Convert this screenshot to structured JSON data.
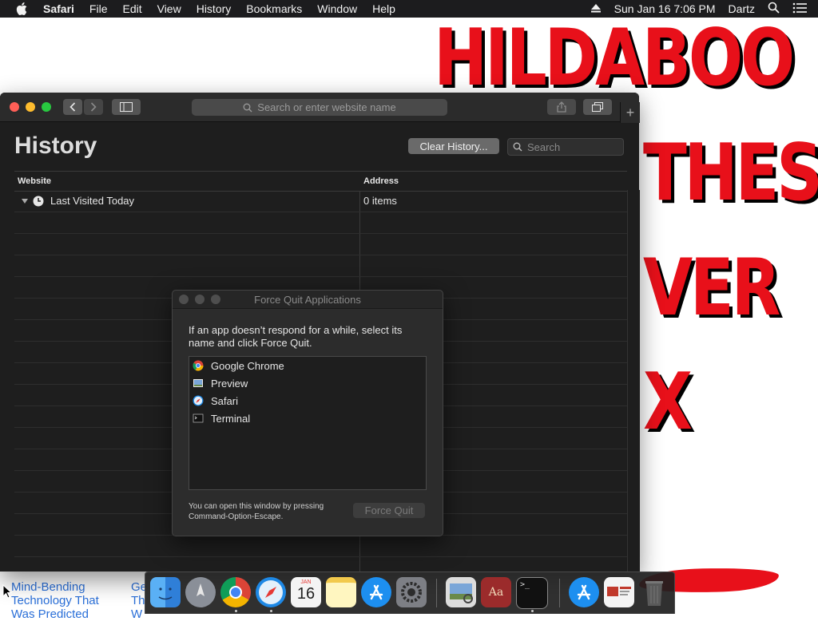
{
  "menubar": {
    "items": [
      "Safari",
      "File",
      "Edit",
      "View",
      "History",
      "Bookmarks",
      "Window",
      "Help"
    ],
    "datetime": "Sun Jan 16  7:06 PM",
    "user": "Dartz"
  },
  "background": {
    "poster_lines": [
      "HILDABOO",
      "THES",
      "VER",
      "X"
    ],
    "links_col1": [
      "Mind-Bending",
      "Technology That",
      "Was Predicted"
    ],
    "links_col2": [
      "Ge",
      "Th",
      "W"
    ]
  },
  "safari": {
    "url_placeholder": "Search or enter website name",
    "page_title": "History",
    "clear_button": "Clear History...",
    "search_placeholder": "Search",
    "columns": [
      "Website",
      "Address"
    ],
    "rows": [
      {
        "website": "Last Visited Today",
        "address": "0 items"
      }
    ]
  },
  "force_quit": {
    "title": "Force Quit Applications",
    "message": "If an app doesn’t respond for a while, select its name and click Force Quit.",
    "apps": [
      {
        "name": "Google Chrome",
        "icon": "chrome-icon"
      },
      {
        "name": "Preview",
        "icon": "preview-icon"
      },
      {
        "name": "Safari",
        "icon": "safari-icon"
      },
      {
        "name": "Terminal",
        "icon": "terminal-icon"
      }
    ],
    "footer_line1": "You can open this window by pressing",
    "footer_line2": "Command-Option-Escape.",
    "button": "Force Quit"
  },
  "dock": {
    "calendar_month": "JAN",
    "calendar_day": "16",
    "apps": [
      "finder-icon",
      "launchpad-icon",
      "chrome-icon",
      "safari-icon",
      "calendar-icon",
      "notes-icon",
      "app-store-icon",
      "system-preferences-icon",
      "preview-icon",
      "dictionary-icon",
      "terminal-icon",
      "app-store-downloads-icon",
      "image-document-icon",
      "trash-icon"
    ]
  },
  "colors": {
    "accent_red": "#e8101a",
    "link_blue": "#2a6fd8",
    "window_bg": "#1e1e1e"
  }
}
